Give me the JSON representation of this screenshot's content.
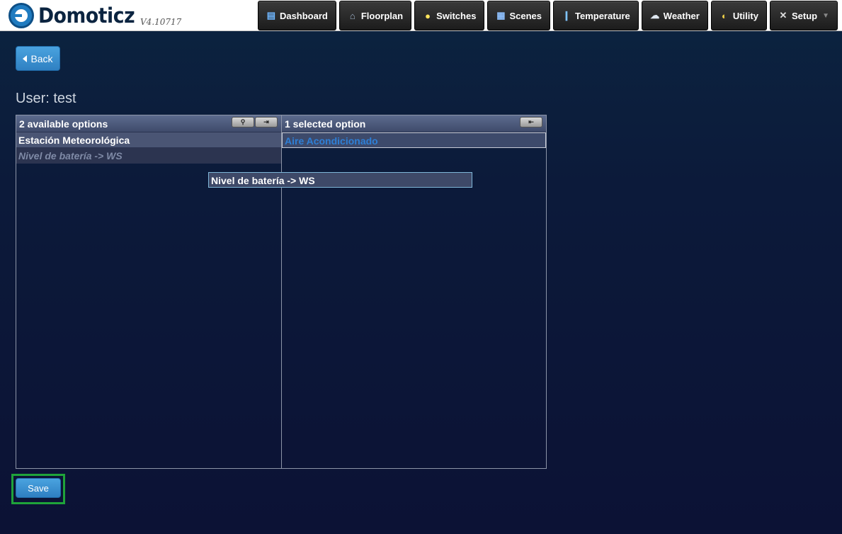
{
  "app": {
    "name": "Domoticz",
    "version": "V4.10717"
  },
  "nav": [
    {
      "label": "Dashboard",
      "icon": "dashboard-icon"
    },
    {
      "label": "Floorplan",
      "icon": "house-icon"
    },
    {
      "label": "Switches",
      "icon": "lightbulb-icon"
    },
    {
      "label": "Scenes",
      "icon": "clapperboard-icon"
    },
    {
      "label": "Temperature",
      "icon": "thermometer-icon"
    },
    {
      "label": "Weather",
      "icon": "cloud-icon"
    },
    {
      "label": "Utility",
      "icon": "utility-icon"
    },
    {
      "label": "Setup",
      "icon": "tools-icon"
    }
  ],
  "back_label": "Back",
  "user_title": "User: test",
  "available": {
    "header": "2 available options",
    "items": [
      "Estación Meteorológica",
      "Nivel de batería -> WS"
    ]
  },
  "selected": {
    "header": "1 selected option",
    "items": [
      "Aire Acondicionado"
    ]
  },
  "dragging_item": "Nivel de batería -> WS",
  "save_label": "Save"
}
